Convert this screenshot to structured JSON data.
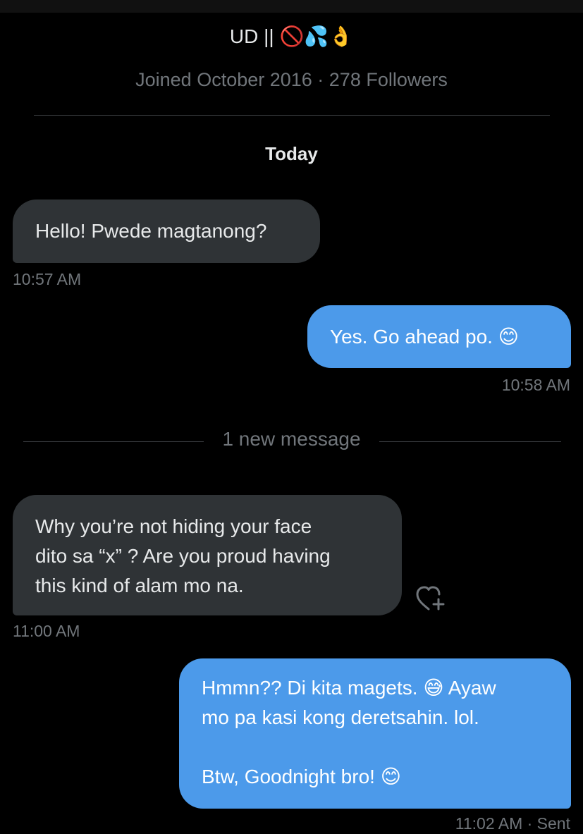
{
  "header": {
    "profile_name": "UD || 🚫💦👌",
    "profile_meta": "Joined October 2016 · 278 Followers"
  },
  "conversation": {
    "day_label": "Today",
    "new_message_divider": "1 new message",
    "messages": [
      {
        "direction": "received",
        "text": "Hello! Pwede magtanong?",
        "time": "10:57 AM"
      },
      {
        "direction": "sent",
        "text": "Yes. Go ahead po. 😊",
        "time": "10:58 AM"
      },
      {
        "direction": "received",
        "text": "Why you’re not hiding your face\ndito sa “x” ? Are you proud having\nthis kind of alam mo na.",
        "time": "11:00 AM"
      },
      {
        "direction": "sent",
        "text": "Hmmn?? Di kita magets. 😅  Ayaw\nmo pa kasi kong deretsahin. lol.\n\nBtw, Goodnight bro! 😊",
        "time": "11:02 AM · Sent"
      }
    ]
  },
  "icons": {
    "react": "heart-plus-icon"
  },
  "colors": {
    "background": "#000000",
    "received_bubble": "#2f3336",
    "sent_bubble": "#4c9aea",
    "muted_text": "#71767b"
  }
}
